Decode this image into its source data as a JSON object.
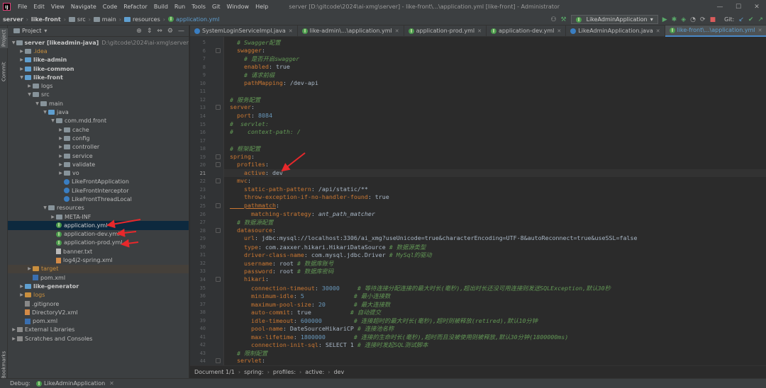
{
  "menubar": {
    "items": [
      "File",
      "Edit",
      "View",
      "Navigate",
      "Code",
      "Refactor",
      "Build",
      "Run",
      "Tools",
      "Git",
      "Window",
      "Help"
    ],
    "title": "server [D:\\gitcode\\2024\\ai-xmg\\server] - like-front\\...\\application.yml [like-front] - Administrator"
  },
  "navbar": {
    "crumbs": [
      "server",
      "like-front",
      "src",
      "main",
      "resources",
      "application.yml"
    ],
    "run_config": "LikeAdminApplication",
    "git_label": "Git:"
  },
  "project": {
    "title": "Project",
    "tree": [
      {
        "label": "server [likeadmin-java]",
        "hint": "D:\\gitcode\\2024\\ai-xmg\\server",
        "depth": 0,
        "arrow": "v",
        "icon": "folder",
        "bold": true
      },
      {
        "label": ".idea",
        "depth": 1,
        "arrow": ">",
        "icon": "folder",
        "orange": true
      },
      {
        "label": "like-admin",
        "depth": 1,
        "arrow": ">",
        "icon": "folder-blue",
        "bold": true
      },
      {
        "label": "like-common",
        "depth": 1,
        "arrow": ">",
        "icon": "folder-blue",
        "bold": true
      },
      {
        "label": "like-front",
        "depth": 1,
        "arrow": "v",
        "icon": "folder-blue",
        "bold": true
      },
      {
        "label": "logs",
        "depth": 2,
        "arrow": ">",
        "icon": "folder"
      },
      {
        "label": "src",
        "depth": 2,
        "arrow": "v",
        "icon": "folder"
      },
      {
        "label": "main",
        "depth": 3,
        "arrow": "v",
        "icon": "folder"
      },
      {
        "label": "java",
        "depth": 4,
        "arrow": "v",
        "icon": "folder-blue"
      },
      {
        "label": "com.mdd.front",
        "depth": 5,
        "arrow": "v",
        "icon": "folder"
      },
      {
        "label": "cache",
        "depth": 6,
        "arrow": ">",
        "icon": "folder"
      },
      {
        "label": "config",
        "depth": 6,
        "arrow": ">",
        "icon": "folder"
      },
      {
        "label": "controller",
        "depth": 6,
        "arrow": ">",
        "icon": "folder"
      },
      {
        "label": "service",
        "depth": 6,
        "arrow": ">",
        "icon": "folder"
      },
      {
        "label": "validate",
        "depth": 6,
        "arrow": ">",
        "icon": "folder"
      },
      {
        "label": "vo",
        "depth": 6,
        "arrow": ">",
        "icon": "folder"
      },
      {
        "label": "LikeFrontApplication",
        "depth": 6,
        "arrow": "",
        "icon": "class"
      },
      {
        "label": "LikeFrontInterceptor",
        "depth": 6,
        "arrow": "",
        "icon": "class"
      },
      {
        "label": "LikeFrontThreadLocal",
        "depth": 6,
        "arrow": "",
        "icon": "class"
      },
      {
        "label": "resources",
        "depth": 4,
        "arrow": "v",
        "icon": "folder"
      },
      {
        "label": "META-INF",
        "depth": 5,
        "arrow": ">",
        "icon": "folder"
      },
      {
        "label": "application.yml",
        "depth": 5,
        "arrow": "",
        "icon": "yml",
        "selected": true
      },
      {
        "label": "application-dev.yml",
        "depth": 5,
        "arrow": "",
        "icon": "yml"
      },
      {
        "label": "application-prod.yml",
        "depth": 5,
        "arrow": "",
        "icon": "yml"
      },
      {
        "label": "banner.txt",
        "depth": 5,
        "arrow": "",
        "icon": "txt"
      },
      {
        "label": "log4j2-spring.xml",
        "depth": 5,
        "arrow": "",
        "icon": "xml"
      },
      {
        "label": "target",
        "depth": 2,
        "arrow": ">",
        "icon": "folder-orange",
        "target": true
      },
      {
        "label": "pom.xml",
        "depth": 2,
        "arrow": "",
        "icon": "m"
      },
      {
        "label": "like-generator",
        "depth": 1,
        "arrow": ">",
        "icon": "folder-blue",
        "bold": true
      },
      {
        "label": "logs",
        "depth": 1,
        "arrow": ">",
        "icon": "folder-orange",
        "orange": true
      },
      {
        "label": ".gitignore",
        "depth": 1,
        "arrow": "",
        "icon": "git"
      },
      {
        "label": "DirectoryV2.xml",
        "depth": 1,
        "arrow": "",
        "icon": "xml"
      },
      {
        "label": "pom.xml",
        "depth": 1,
        "arrow": "",
        "icon": "m"
      },
      {
        "label": "External Libraries",
        "depth": 0,
        "arrow": ">",
        "icon": "lib"
      },
      {
        "label": "Scratches and Consoles",
        "depth": 0,
        "arrow": ">",
        "icon": "lib"
      }
    ]
  },
  "side_tabs": {
    "project": "Project",
    "commit": "Commit",
    "bookmarks": "Bookmarks"
  },
  "tabs": [
    {
      "label": "SystemLoginServiceImpl.java",
      "icon": "java"
    },
    {
      "label": "like-admin\\...\\application.yml",
      "icon": "yml"
    },
    {
      "label": "application-prod.yml",
      "icon": "yml"
    },
    {
      "label": "application-dev.yml",
      "icon": "yml"
    },
    {
      "label": "LikeAdminApplication.java",
      "icon": "java"
    },
    {
      "label": "like-front\\...\\application.yml",
      "icon": "yml",
      "active": true
    }
  ],
  "editor": {
    "current_line": 21,
    "lines": [
      {
        "n": 5,
        "segs": [
          [
            "c",
            "  # Swagger配置"
          ]
        ]
      },
      {
        "n": 6,
        "segs": [
          [
            "k",
            "  swagger"
          ],
          [
            "s",
            ":"
          ]
        ]
      },
      {
        "n": 7,
        "segs": [
          [
            "c",
            "    # 是否开启swagger"
          ]
        ]
      },
      {
        "n": 8,
        "segs": [
          [
            "k",
            "    enabled"
          ],
          [
            "s",
            ": true"
          ]
        ]
      },
      {
        "n": 9,
        "segs": [
          [
            "c",
            "    # 请求前缀"
          ]
        ]
      },
      {
        "n": 10,
        "segs": [
          [
            "k",
            "    pathMapping"
          ],
          [
            "s",
            ": /dev-api"
          ]
        ]
      },
      {
        "n": 11,
        "segs": []
      },
      {
        "n": 12,
        "segs": [
          [
            "c",
            "# 服务配置"
          ]
        ]
      },
      {
        "n": 13,
        "segs": [
          [
            "k",
            "server"
          ],
          [
            "s",
            ":"
          ]
        ]
      },
      {
        "n": 14,
        "segs": [
          [
            "k",
            "  port"
          ],
          [
            "s",
            ": "
          ],
          [
            "n",
            "8084"
          ]
        ]
      },
      {
        "n": 15,
        "segs": [
          [
            "c",
            "#  servlet:"
          ]
        ]
      },
      {
        "n": 16,
        "segs": [
          [
            "c",
            "#    context-path: /"
          ]
        ]
      },
      {
        "n": 17,
        "segs": []
      },
      {
        "n": 18,
        "segs": [
          [
            "c",
            "# 框架配置"
          ]
        ]
      },
      {
        "n": 19,
        "segs": [
          [
            "k",
            "spring"
          ],
          [
            "s",
            ":"
          ]
        ]
      },
      {
        "n": 20,
        "segs": [
          [
            "k",
            "  profiles"
          ],
          [
            "s",
            ":"
          ]
        ]
      },
      {
        "n": 21,
        "segs": [
          [
            "k",
            "    active"
          ],
          [
            "s",
            ": dev"
          ]
        ]
      },
      {
        "n": 22,
        "segs": [
          [
            "k",
            "  mvc"
          ],
          [
            "s",
            ":"
          ]
        ]
      },
      {
        "n": 23,
        "segs": [
          [
            "k",
            "    static-path-pattern"
          ],
          [
            "s",
            ": /api/static/**"
          ]
        ]
      },
      {
        "n": 24,
        "segs": [
          [
            "k",
            "    throw-exception-if-no-handler-found"
          ],
          [
            "s",
            ": true"
          ]
        ]
      },
      {
        "n": 25,
        "segs": [
          [
            "ku",
            "    pathmatch"
          ],
          [
            "s",
            ":"
          ]
        ]
      },
      {
        "n": 26,
        "segs": [
          [
            "k",
            "      matching-strategy"
          ],
          [
            "s",
            ": "
          ],
          [
            "i",
            "ant_path_matcher"
          ]
        ]
      },
      {
        "n": 27,
        "segs": [
          [
            "c",
            "  # 数据源配置"
          ]
        ]
      },
      {
        "n": 28,
        "segs": [
          [
            "k",
            "  datasource"
          ],
          [
            "s",
            ":"
          ]
        ]
      },
      {
        "n": 29,
        "segs": [
          [
            "k",
            "    url"
          ],
          [
            "s",
            ": jdbc:mysql://localhost:3306/ai_xmg?useUnicode=true&characterEncoding=UTF-8&autoReconnect=true&useSSL=false"
          ]
        ]
      },
      {
        "n": 30,
        "segs": [
          [
            "k",
            "    type"
          ],
          [
            "s",
            ": com.zaxxer.hikari.HikariDataSource "
          ],
          [
            "c",
            "# 数据源类型"
          ]
        ]
      },
      {
        "n": 31,
        "segs": [
          [
            "k",
            "    driver-class-name"
          ],
          [
            "s",
            ": com.mysql.jdbc.Driver "
          ],
          [
            "c",
            "# MySql的驱动"
          ]
        ]
      },
      {
        "n": 32,
        "segs": [
          [
            "k",
            "    username"
          ],
          [
            "s",
            ": root "
          ],
          [
            "c",
            "# 数据库账号"
          ]
        ]
      },
      {
        "n": 33,
        "segs": [
          [
            "k",
            "    password"
          ],
          [
            "s",
            ": root "
          ],
          [
            "c",
            "# 数据库密码"
          ]
        ]
      },
      {
        "n": 34,
        "segs": [
          [
            "k",
            "    hikari"
          ],
          [
            "s",
            ":"
          ]
        ]
      },
      {
        "n": 35,
        "segs": [
          [
            "k",
            "      connection-timeout"
          ],
          [
            "s",
            ": "
          ],
          [
            "n",
            "30000"
          ],
          [
            "s",
            "     "
          ],
          [
            "c",
            "# 等待连接分配连接的最大时长(毫秒),超出时长还没可用连接则发送SQLException,默认30秒"
          ]
        ]
      },
      {
        "n": 36,
        "segs": [
          [
            "k",
            "      minimum-idle"
          ],
          [
            "s",
            ": "
          ],
          [
            "n",
            "5"
          ],
          [
            "s",
            "              "
          ],
          [
            "c",
            "# 最小连接数"
          ]
        ]
      },
      {
        "n": 37,
        "segs": [
          [
            "k",
            "      maximum-pool-size"
          ],
          [
            "s",
            ": "
          ],
          [
            "n",
            "20"
          ],
          [
            "s",
            "        "
          ],
          [
            "c",
            "# 最大连接数"
          ]
        ]
      },
      {
        "n": 38,
        "segs": [
          [
            "k",
            "      auto-commit"
          ],
          [
            "s",
            ": true"
          ],
          [
            "s",
            "           "
          ],
          [
            "c",
            "# 自动提交"
          ]
        ]
      },
      {
        "n": 39,
        "segs": [
          [
            "k",
            "      idle-timeout"
          ],
          [
            "s",
            ": "
          ],
          [
            "n",
            "600000"
          ],
          [
            "s",
            "         "
          ],
          [
            "c",
            "# 连接超时的最大时长(毫秒),超时则被释放(retired),默认10分钟"
          ]
        ]
      },
      {
        "n": 40,
        "segs": [
          [
            "k",
            "      pool-name"
          ],
          [
            "s",
            ": DateSourceHikariCP "
          ],
          [
            "c",
            "# 连接池名称"
          ]
        ]
      },
      {
        "n": 41,
        "segs": [
          [
            "k",
            "      max-lifetime"
          ],
          [
            "s",
            ": "
          ],
          [
            "n",
            "1800000"
          ],
          [
            "s",
            "        "
          ],
          [
            "c",
            "# 连接的生命时长(毫秒),超时而且没被使用则被释放,默认30分钟(1800000ms)"
          ]
        ]
      },
      {
        "n": 42,
        "segs": [
          [
            "k",
            "      connection-init-sql"
          ],
          [
            "s",
            ": SELECT 1 "
          ],
          [
            "c",
            "# 连接时发起SQL测试脚本"
          ]
        ]
      },
      {
        "n": 43,
        "segs": [
          [
            "c",
            "  # 限制配置"
          ]
        ]
      },
      {
        "n": 44,
        "segs": [
          [
            "k",
            "  servlet"
          ],
          [
            "s",
            ":"
          ]
        ]
      }
    ]
  },
  "breadcrumbs": [
    "Document 1/1",
    "spring:",
    "profiles:",
    "active:",
    "dev"
  ],
  "debugbar": {
    "label": "Debug:",
    "config": "LikeAdminApplication"
  }
}
